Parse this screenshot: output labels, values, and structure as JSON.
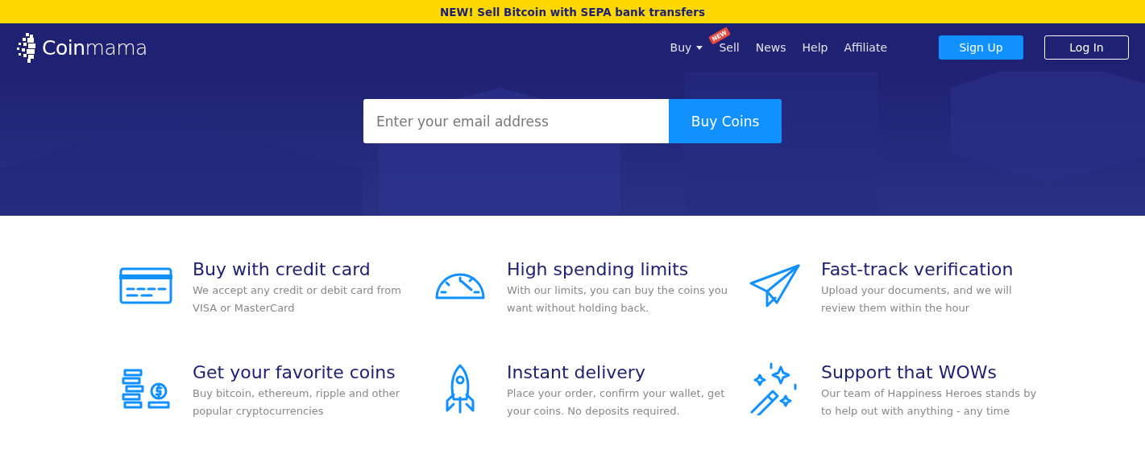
{
  "banner": {
    "text": "NEW! Sell Bitcoin with SEPA bank transfers"
  },
  "logo": {
    "text": "**Coin**mama"
  },
  "nav": {
    "links": [
      {
        "label": "Buy",
        "kind": "dropdown"
      },
      {
        "label": "Sell",
        "kind": "new",
        "badge": "NEW"
      },
      {
        "label": "News",
        "kind": "plain"
      },
      {
        "label": "Help",
        "kind": "plain"
      },
      {
        "label": "Affiliate",
        "kind": "plain"
      }
    ],
    "buttons": [
      {
        "label": "Sign Up",
        "kind": "primary"
      },
      {
        "label": "Log In",
        "kind": "outline"
      }
    ]
  },
  "hero": {
    "email": {
      "placeholder": "Enter your email address"
    },
    "button": "Buy Coins"
  },
  "features": [
    {
      "title": "Buy with credit card",
      "text": "We accept any credit or debit card from VISA or MasterCard"
    },
    {
      "title": "High spending limits",
      "text": "With our limits, you can buy the coins you want without holding back."
    },
    {
      "title": "Fast-track verification",
      "text": "Upload your documents, and we will review them within the hour"
    },
    {
      "title": "Get your favorite coins",
      "text": "Buy bitcoin, ethereum, ripple and other popular cryptocurrencies"
    },
    {
      "title": "Instant delivery",
      "text": "Place your order, confirm your wallet, get your coins. No deposits required."
    },
    {
      "title": "Support that WOWs",
      "text": "Our team of Happiness Heroes stands by to help out with anything - any time"
    }
  ]
}
